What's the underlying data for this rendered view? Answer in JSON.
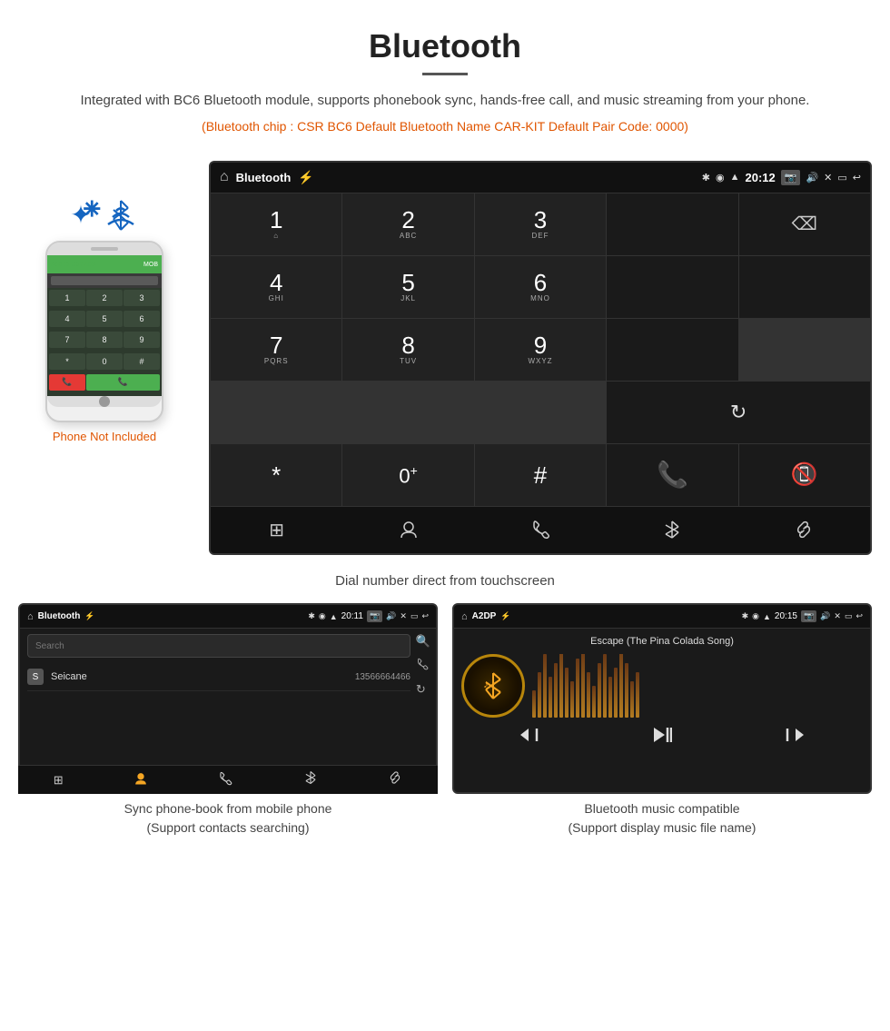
{
  "header": {
    "title": "Bluetooth",
    "description": "Integrated with BC6 Bluetooth module, supports phonebook sync, hands-free call, and music streaming from your phone.",
    "specs": "(Bluetooth chip : CSR BC6    Default Bluetooth Name CAR-KIT    Default Pair Code: 0000)"
  },
  "phone_note": "Phone Not Included",
  "dialpad": {
    "caption": "Dial number direct from touchscreen",
    "status_bar": {
      "app_name": "Bluetooth",
      "time": "20:12"
    },
    "keys": [
      {
        "num": "1",
        "sub": "⌂"
      },
      {
        "num": "2",
        "sub": "ABC"
      },
      {
        "num": "3",
        "sub": "DEF"
      },
      {
        "num": "*",
        "sub": ""
      },
      {
        "num": "0",
        "sub": "+"
      },
      {
        "num": "#",
        "sub": ""
      },
      {
        "num": "4",
        "sub": "GHI"
      },
      {
        "num": "5",
        "sub": "JKL"
      },
      {
        "num": "6",
        "sub": "MNO"
      },
      {
        "num": "7",
        "sub": "PQRS"
      },
      {
        "num": "8",
        "sub": "TUV"
      },
      {
        "num": "9",
        "sub": "WXYZ"
      }
    ],
    "nav_icons": [
      "⊞",
      "👤",
      "📞",
      "✱",
      "🔗"
    ]
  },
  "phonebook": {
    "caption_line1": "Sync phone-book from mobile phone",
    "caption_line2": "(Support contacts searching)",
    "status_bar": {
      "app_name": "Bluetooth",
      "time": "20:11"
    },
    "search_placeholder": "Search",
    "contacts": [
      {
        "initial": "S",
        "name": "Seicane",
        "number": "13566664466"
      }
    ],
    "nav_icons": [
      "⊞",
      "👤",
      "📞",
      "✱",
      "🔗"
    ]
  },
  "music": {
    "caption_line1": "Bluetooth music compatible",
    "caption_line2": "(Support display music file name)",
    "status_bar": {
      "app_name": "A2DP",
      "time": "20:15"
    },
    "song_title": "Escape (The Pina Colada Song)",
    "eq_bars": [
      30,
      50,
      70,
      45,
      60,
      80,
      55,
      40,
      65,
      75,
      50,
      35,
      60,
      70,
      45,
      55,
      80,
      60,
      40,
      50
    ],
    "controls": [
      "⏮",
      "⏯",
      "⏭"
    ]
  }
}
